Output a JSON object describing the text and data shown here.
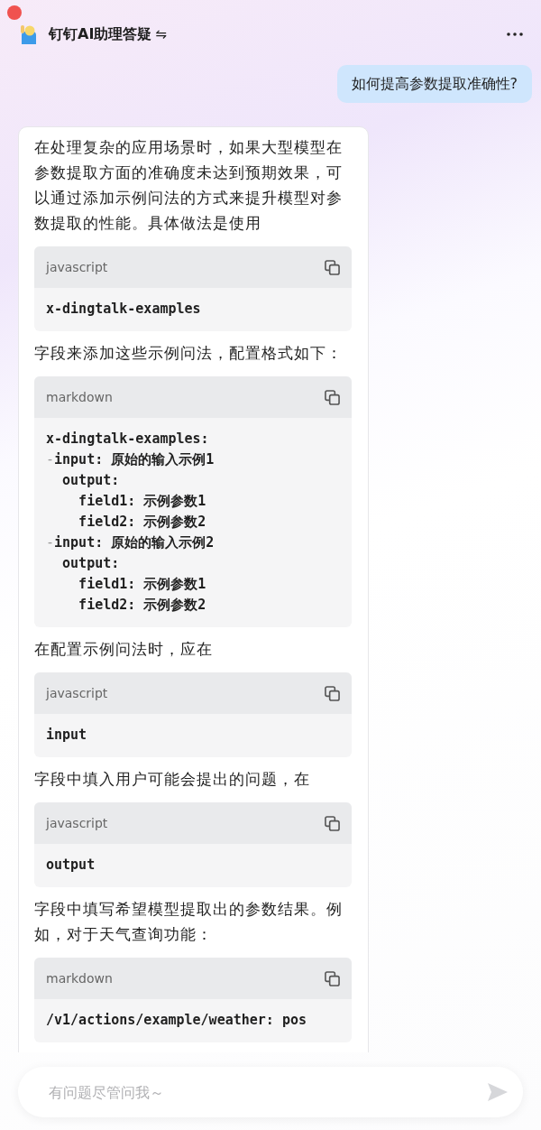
{
  "header": {
    "title": "钉钉AI助理答疑",
    "switch_icon": "⇋"
  },
  "messages": [
    {
      "kind": "user",
      "text": "如何提高参数提取准确性?"
    },
    {
      "kind": "bot",
      "blocks": [
        {
          "kind": "text",
          "text": "在处理复杂的应用场景时，如果大型模型在参数提取方面的准确度未达到预期效果，可以通过添加示例问法的方式来提升模型对参数提取的性能。具体做法是使用"
        },
        {
          "kind": "code",
          "lang": "javascript",
          "lines": [
            {
              "text": "x-dingtalk-examples"
            }
          ]
        },
        {
          "kind": "text",
          "text": "字段来添加这些示例问法，配置格式如下："
        },
        {
          "kind": "code",
          "lang": "markdown",
          "lines": [
            {
              "text": "x-dingtalk-examples:"
            },
            {
              "dash": "-",
              "text": "input: 原始的输入示例1"
            },
            {
              "text": "  output:"
            },
            {
              "text": "    field1: 示例参数1"
            },
            {
              "text": "    field2: 示例参数2"
            },
            {
              "dash": "-",
              "text": "input: 原始的输入示例2"
            },
            {
              "text": "  output:"
            },
            {
              "text": "    field1: 示例参数1"
            },
            {
              "text": "    field2: 示例参数2"
            }
          ]
        },
        {
          "kind": "text",
          "text": "在配置示例问法时，应在"
        },
        {
          "kind": "code",
          "lang": "javascript",
          "lines": [
            {
              "text": "input"
            }
          ]
        },
        {
          "kind": "text",
          "text": "字段中填入用户可能会提出的问题，在"
        },
        {
          "kind": "code",
          "lang": "javascript",
          "lines": [
            {
              "text": "output"
            }
          ]
        },
        {
          "kind": "text",
          "text": "字段中填写希望模型提取出的参数结果。例如，对于天气查询功能："
        },
        {
          "kind": "code",
          "lang": "markdown",
          "lines": [
            {
              "text": "/v1/actions/example/weather: pos"
            }
          ]
        }
      ]
    }
  ],
  "composer": {
    "placeholder": "有问题尽管问我～"
  }
}
